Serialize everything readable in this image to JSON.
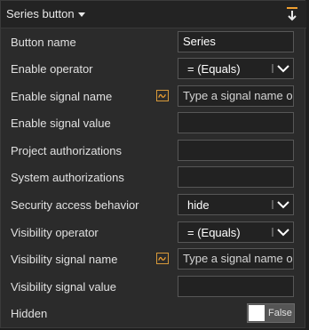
{
  "header": {
    "title": "Series button"
  },
  "rows": [
    {
      "label": "Button name",
      "value": "Series"
    },
    {
      "label": "Enable operator",
      "value": "= (Equals)"
    },
    {
      "label": "Enable signal name",
      "placeholder": "Type a signal name o"
    },
    {
      "label": "Enable signal value",
      "value": ""
    },
    {
      "label": "Project authorizations",
      "value": ""
    },
    {
      "label": "System authorizations",
      "value": ""
    },
    {
      "label": "Security access behavior",
      "value": "hide"
    },
    {
      "label": "Visibility operator",
      "value": "= (Equals)"
    },
    {
      "label": "Visibility signal name",
      "placeholder": "Type a signal name o"
    },
    {
      "label": "Visibility signal value",
      "value": ""
    },
    {
      "label": "Hidden",
      "value": "False"
    }
  ],
  "colors": {
    "accent": "#f0a030",
    "field_bg": "#222222",
    "panel_bg": "#2b2b2b"
  },
  "icons": {
    "pin": "pin-down-icon",
    "signal": "signal-wave-icon",
    "dropdown": "chevron-down-icon"
  }
}
